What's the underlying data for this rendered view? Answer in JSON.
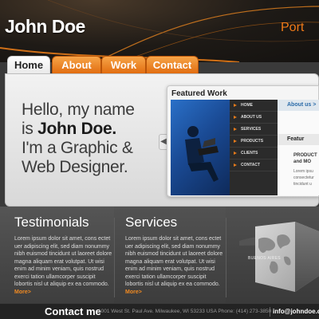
{
  "header": {
    "logo": "John Doe",
    "portfolio_label": "Port"
  },
  "nav": {
    "tabs": [
      "Home",
      "About",
      "Work",
      "Contact"
    ],
    "active": "Home"
  },
  "hero": {
    "line1": "Hello, my name",
    "line2_prefix": "is ",
    "line2_name": "John Doe.",
    "line3": "I'm a Graphic &",
    "line4": "Web Designer.",
    "arrow": "◀"
  },
  "featured": {
    "title": "Featured Work",
    "menu": [
      "HOME",
      "ABOUT US",
      "SERVICES",
      "PRODUCTS",
      "CLIENTS",
      "CONTACT"
    ],
    "about_tab": "About us >",
    "feature_tab": "Featur",
    "product_line1": "PRODUCT",
    "product_line2": "and MO",
    "lorem_lines": [
      "Lorem ipsu",
      "consectetur",
      "tincidunt u"
    ]
  },
  "testimonials": {
    "title": "Testimonials",
    "body": "Lorem ipsum dolor sit amet, cons ectet uer adipiscing elit, sed diam nonummy nibh euismod tincidunt ut laoreet dolore magna aliquam erat volutpat. Ut wisi enim ad minim veniam, quis nostrud exerci tation ullamcorper suscipit lobortis nisl ut aliquip ex ea commodo.",
    "more": "More>"
  },
  "services": {
    "title": "Services",
    "body": "Lorem ipsum dolor sit amet, cons ectet uer adipiscing elit, sed diam nonummy nibh euismod tincidunt ut laoreet dolore magna aliquam erat volutpat. Ut wisi enim ad minim veniam, quis nostrud exerci tation ullamcorper suscipit lobortis nisl ut aliquip ex ea commodo.",
    "more": "More>"
  },
  "cube": {
    "label": "BUENOS AIRES"
  },
  "footer": {
    "title": "Contact me",
    "address": "1001 West St. Paul Ave. Milwaukee, WI 53233 USA Phone: (414) 273-3850",
    "email": "info@johndoe.com"
  },
  "colors": {
    "accent": "#e8761a",
    "header_bg": "#1e1a16",
    "panel_bg": "#ececec"
  }
}
